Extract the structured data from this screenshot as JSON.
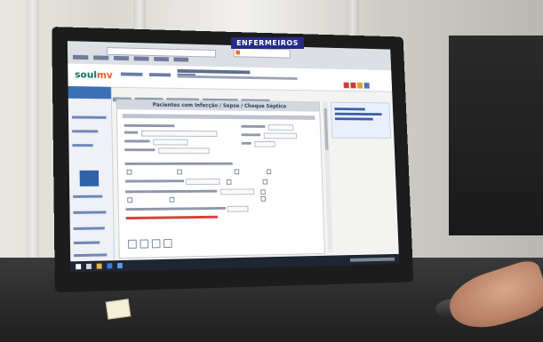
{
  "photo": {
    "overlay_title": "ENFERMEIROS"
  },
  "app": {
    "logo_prefix": "soul",
    "logo_suffix": "mv"
  },
  "form": {
    "panel_title": "Pacientes com Infecção / Sepse / Choque Séptico"
  },
  "colors": {
    "brand_green": "#0c6f5b",
    "brand_orange": "#e2612a",
    "title_bar_blue": "#262a8a",
    "alert_red": "#d3433b",
    "sidebar_blue": "#3d6fb4"
  }
}
